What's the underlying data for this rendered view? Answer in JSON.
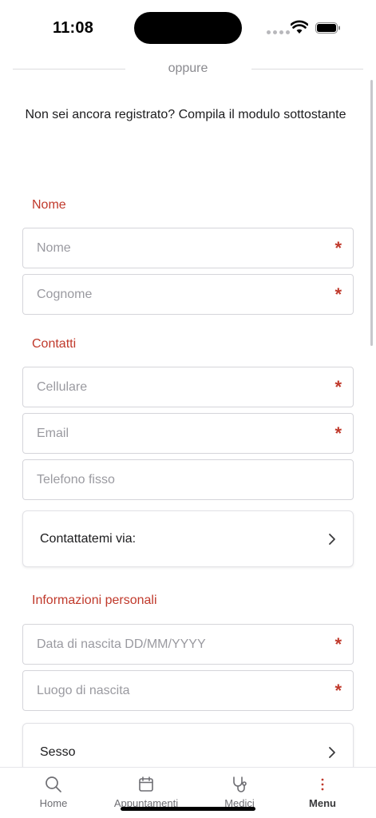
{
  "status": {
    "time": "11:08"
  },
  "divider": {
    "text": "oppure"
  },
  "hint": "Non sei ancora registrato? Compila il modulo sottostante",
  "sections": {
    "nome": "Nome",
    "contatti": "Contatti",
    "personali": "Informazioni personali"
  },
  "fields": {
    "nome": {
      "placeholder": "Nome",
      "required": "*"
    },
    "cognome": {
      "placeholder": "Cognome",
      "required": "*"
    },
    "cellulare": {
      "placeholder": "Cellulare",
      "required": "*"
    },
    "email": {
      "placeholder": "Email",
      "required": "*"
    },
    "telefono": {
      "placeholder": "Telefono fisso"
    },
    "nascita": {
      "placeholder": "Data di nascita DD/MM/YYYY",
      "required": "*"
    },
    "luogo": {
      "placeholder": "Luogo di nascita",
      "required": "*"
    }
  },
  "selects": {
    "contatto": {
      "label": "Contattatemi via:",
      "icon": "chevron-right-icon"
    },
    "sesso": {
      "label": "Sesso",
      "icon": "chevron-right-icon"
    }
  },
  "tabs": [
    {
      "label": "Home",
      "icon": "search-icon"
    },
    {
      "label": "Appuntamenti",
      "icon": "calendar-icon"
    },
    {
      "label": "Medici",
      "icon": "stethoscope-icon"
    },
    {
      "label": "Menu",
      "icon": "more-vertical-icon"
    }
  ],
  "colors": {
    "accent": "#c0392b",
    "text": "#1c1c1e",
    "placeholder": "#9a9aa0",
    "border": "#d5d5da"
  }
}
